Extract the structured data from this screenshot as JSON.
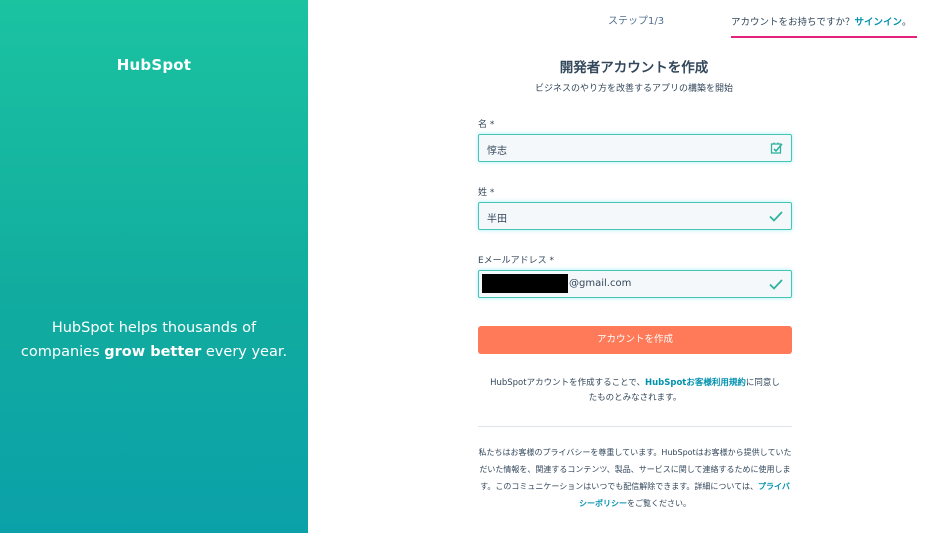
{
  "left": {
    "logo_text": "HubSpot",
    "tagline_line1": "HubSpot helps thousands of",
    "tagline_prefix": "companies ",
    "tagline_bold": "grow better",
    "tagline_suffix": " every year."
  },
  "header": {
    "step": "ステップ1/3",
    "have_account": "アカウントをお持ちですか？",
    "signin_link": "サインイン",
    "signin_period": "。"
  },
  "form": {
    "title": "開発者アカウントを作成",
    "subtitle": "ビジネスのやり方を改善するアプリの構築を開始",
    "first_name_label": "名 *",
    "first_name_value": "惇志",
    "last_name_label": "姓 *",
    "last_name_value": "半田",
    "email_label": "Eメールアドレス *",
    "email_value_visible": "@gmail.com",
    "submit_label": "アカウントを作成"
  },
  "terms": {
    "text_before": "HubSpotアカウントを作成することで、",
    "link": "HubSpotお客様利用規約",
    "text_after": "に同意したものとみなされます。"
  },
  "privacy": {
    "text_before": "私たちはお客様のプライバシーを尊重しています。HubSpotはお客様から提供していただいた情報を、関連するコンテンツ、製品、サービスに関して連絡するために使用します。このコミュニケーションはいつでも配信解除できます。詳細については、",
    "link": "プライバシーポリシー",
    "text_after": "をご覧ください。"
  },
  "colors": {
    "left_gradient_top": "#1bc3a1",
    "left_gradient_bottom": "#0ba1a9",
    "accent_button": "#ff7a59",
    "link": "#0091ae",
    "field_border": "#45c5b5",
    "signin_underline": "#e5217a"
  },
  "icons": {
    "first_name_field": "autofill-contact-icon",
    "last_name_field": "check-icon",
    "email_field": "check-icon"
  }
}
